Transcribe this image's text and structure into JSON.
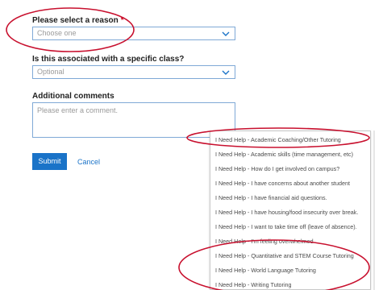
{
  "form": {
    "reason": {
      "label": "Please select a reason",
      "required_mark": "*",
      "placeholder": "Choose one"
    },
    "class": {
      "label": "Is this associated with a specific class?",
      "placeholder": "Optional"
    },
    "comments": {
      "label": "Additional comments",
      "placeholder": "Please enter a comment."
    },
    "submit_label": "Submit",
    "cancel_label": "Cancel"
  },
  "dropdown": {
    "options": [
      "I Need Help - Academic Coaching/Other Tutoring",
      "I Need Help - Academic skills (time management, etc)",
      "I Need Help - How do I get involved on campus?",
      "I Need Help - I have concerns about another student",
      "I Need Help - I have financial aid questions.",
      "I Need Help - I have housing/food insecurity over break.",
      "I Need Help - I want to take time off (leave of absence).",
      "I Need Help - I'm feeling overwhelmed",
      "I Need Help - Quantitative and STEM Course Tutoring",
      "I Need Help - World Language Tutoring",
      "I Need Help - Writing Tutoring"
    ]
  },
  "colors": {
    "accent": "#1a73c8",
    "annotation": "#c8102e",
    "field_border": "#7fa9d6",
    "required": "#d0021b"
  }
}
